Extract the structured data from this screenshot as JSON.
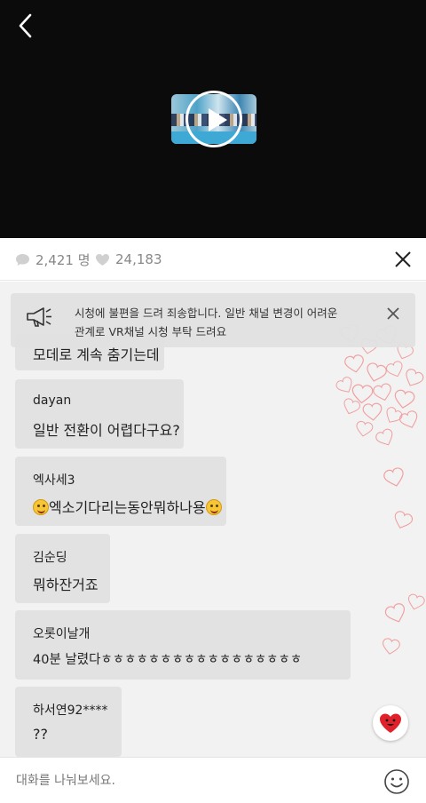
{
  "video": {
    "back_icon": "chevron-left-icon",
    "play_icon": "play-icon"
  },
  "stats": {
    "viewers": "2,421 명",
    "viewers_icon": "chat-bubble-icon",
    "likes": "24,183",
    "likes_icon": "heart-icon",
    "close_icon": "close-icon"
  },
  "notice": {
    "icon": "megaphone-icon",
    "line1": "시청에 불편을 드려 죄송합니다. 일반 채널 변경이 어려운",
    "line2": "관계로 VR채널 시청 부탁 드려요",
    "dismiss_icon": "close-icon"
  },
  "chat": {
    "messages": [
      {
        "name": "",
        "text": "모데로 계속 춤기는데"
      },
      {
        "name": "dayan",
        "text": "일반 전환이 어렵다구요?"
      },
      {
        "name": "엑사세3",
        "text": "엑소기다리는동안뭐하나용"
      },
      {
        "name": "김순딩",
        "text": "뭐하잔거죠"
      },
      {
        "name": "오롯이날개",
        "text": "40분 날렸다ㅎㅎㅎㅎㅎㅎㅎㅎㅎㅎㅎㅎㅎㅎㅎㅎㅎ"
      },
      {
        "name": "하서연92****",
        "text": "??"
      }
    ]
  },
  "like_button": {
    "icon": "heart-face-icon",
    "color": "#e0202a"
  },
  "input": {
    "placeholder": "대화를 나눠보세요.",
    "value": "",
    "emoji_icon": "smile-icon"
  },
  "colors": {
    "video_bg": "#0b0b0b",
    "chat_bg": "#f2f2f2",
    "bubble_bg": "#e2e2e2",
    "heart_outline": "#f0a0a0"
  }
}
